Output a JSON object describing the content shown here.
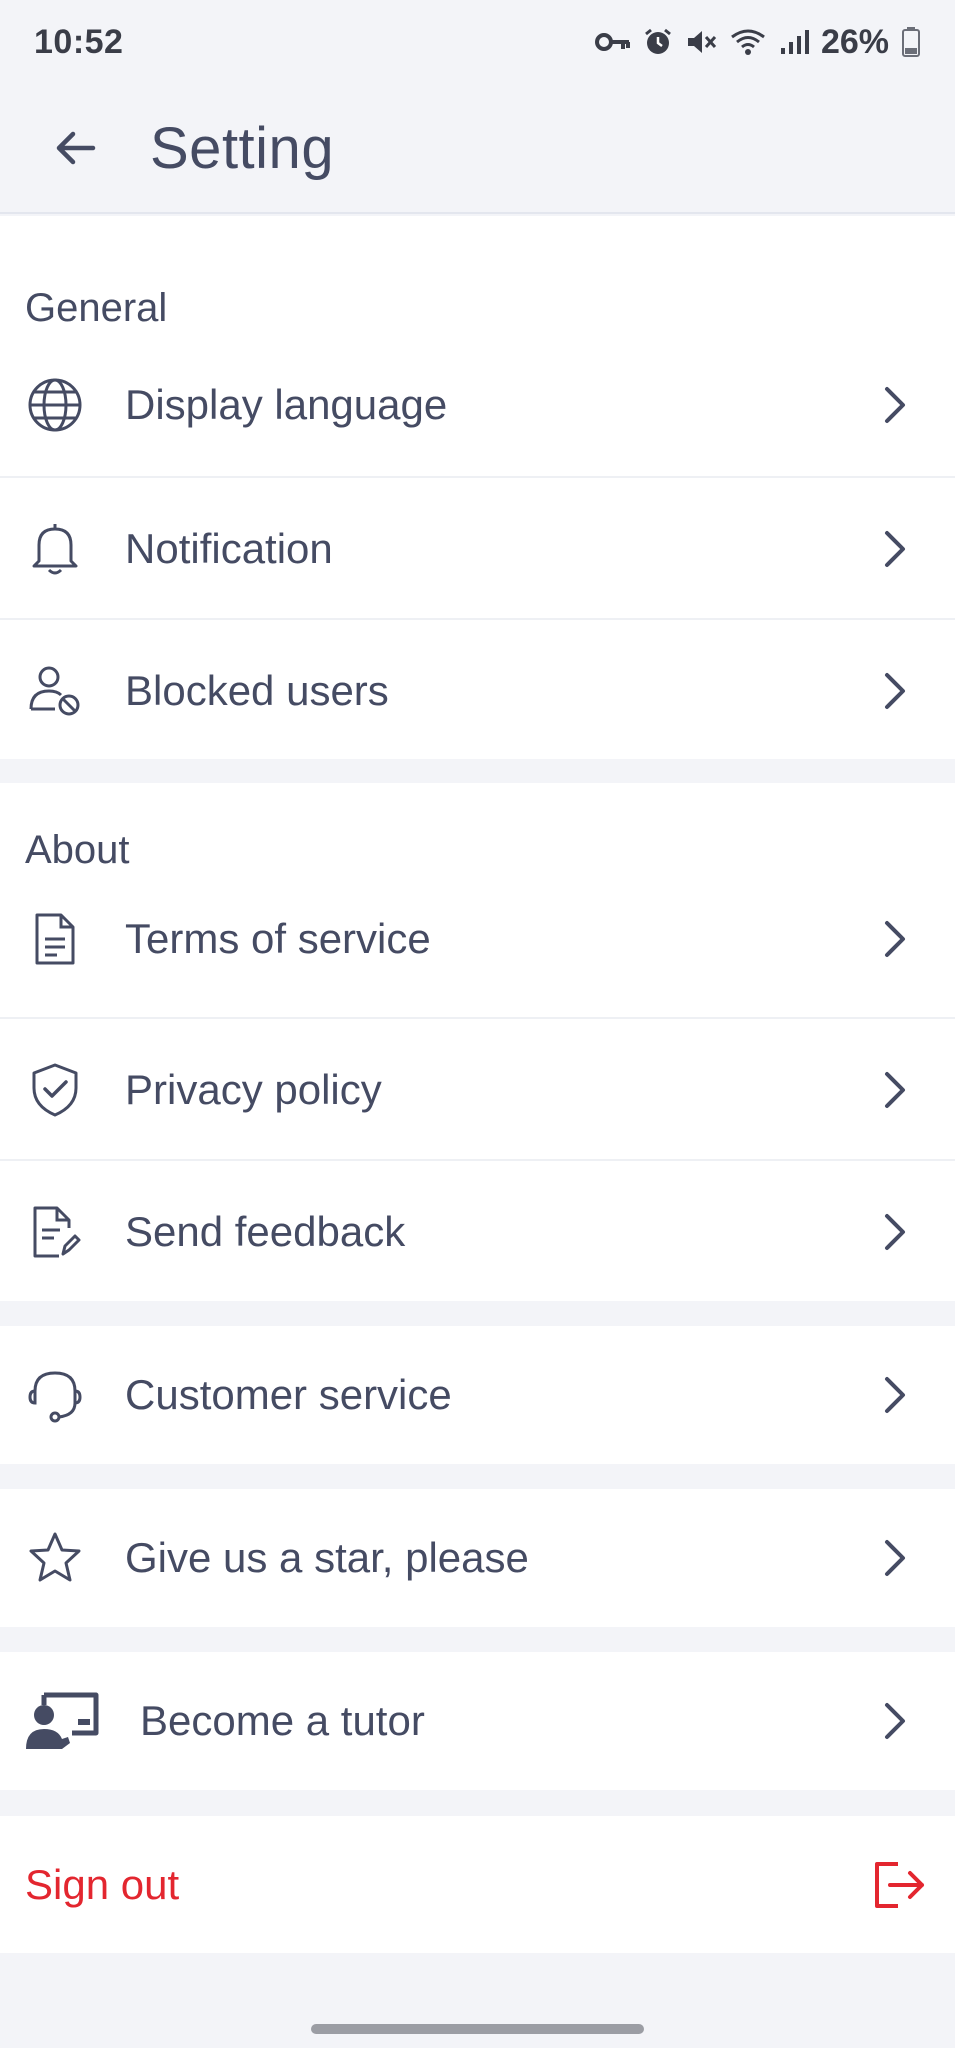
{
  "status_bar": {
    "time": "10:52",
    "battery": "26%"
  },
  "header": {
    "title": "Setting",
    "back_icon": "arrow-left-icon"
  },
  "sections": {
    "general": {
      "title": "General",
      "items": [
        {
          "label": "Display language",
          "icon": "globe-icon"
        },
        {
          "label": "Notification",
          "icon": "bell-icon"
        },
        {
          "label": "Blocked users",
          "icon": "user-blocked-icon"
        }
      ]
    },
    "about": {
      "title": "About",
      "items": [
        {
          "label": "Terms of service",
          "icon": "document-icon"
        },
        {
          "label": "Privacy policy",
          "icon": "shield-check-icon"
        },
        {
          "label": "Send feedback",
          "icon": "document-edit-icon"
        }
      ]
    },
    "customer_service": {
      "label": "Customer service",
      "icon": "headset-icon"
    },
    "rate": {
      "label": "Give us a star, please",
      "icon": "star-icon"
    },
    "tutor": {
      "label": "Become a tutor",
      "icon": "teacher-board-icon"
    },
    "sign_out": {
      "label": "Sign out",
      "icon": "logout-icon"
    }
  },
  "colors": {
    "background": "#f3f4f8",
    "card": "#ffffff",
    "text": "#454b63",
    "danger": "#e3262f"
  }
}
